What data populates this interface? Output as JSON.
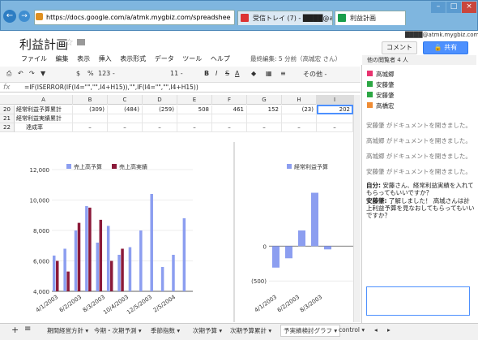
{
  "browser": {
    "url": "https://docs.google.com/a/atmk.mygbiz.com/spreadshee",
    "tabs": [
      {
        "label": "受信トレイ (7) - ████@atmk. ×"
      },
      {
        "label": "利益計画"
      }
    ]
  },
  "header": {
    "title": "利益計画",
    "email": "████@atmk.mygbiz.com",
    "comment_label": "コメント",
    "share_label": "共有",
    "last_edit": "最終編集: 5 分前（高城宏 さん）",
    "menus": [
      "ファイル",
      "編集",
      "表示",
      "挿入",
      "表示形式",
      "データ",
      "ツール",
      "ヘルプ"
    ]
  },
  "toolbar": {
    "currency": "$",
    "percent": "%",
    "format123": "123 -",
    "font_size": "11 -",
    "bold": "B",
    "italic": "I",
    "strike": "S",
    "color": "A",
    "more": "その他 -"
  },
  "formula": {
    "fx": "fx",
    "text": "=IF(ISERROR(IF(I4=\"\",\"\",I4+H15)),\"\",IF(I4=\"\",\"\",I4+H15))"
  },
  "grid": {
    "columns": [
      "A",
      "B",
      "C",
      "D",
      "E",
      "F",
      "G",
      "H",
      "I"
    ],
    "rows": [
      {
        "num": "20",
        "label": "経常利益予算累計",
        "values": [
          "(309)",
          "(484)",
          "(259)",
          "508",
          "461",
          "152",
          "(23)",
          "202"
        ]
      },
      {
        "num": "21",
        "label": "経常利益実績累計",
        "values": [
          "",
          "",
          "",
          "",
          "",
          "",
          "",
          ""
        ]
      },
      {
        "num": "22",
        "label": "達成率",
        "values": [
          "–",
          "–",
          "–",
          "–",
          "–",
          "–",
          "–",
          "–"
        ]
      }
    ]
  },
  "viewers": {
    "label": "他の閲覧者 4 人",
    "list": [
      {
        "name": "高城郷",
        "color": "#e8336f"
      },
      {
        "name": "安藤肇",
        "color": "#2ca744"
      },
      {
        "name": "安藤肇",
        "color": "#2ca744"
      },
      {
        "name": "高橋宏",
        "color": "#ef8c34"
      }
    ]
  },
  "chat": {
    "messages": [
      "安藤肇 がドキュメントを開きました。",
      "高城郷 がドキュメントを開きました。",
      "高城郷 がドキュメントを開きました。",
      "安藤肇 がドキュメントを開きました。"
    ],
    "self_label": "自分:",
    "self_msg": "安藤さん、経常利益実績を入れてもらってもいいですか？",
    "reply_label": "安藤肇:",
    "reply_msg": "了解しました！ 高城さんは計上利益予算を見なおしてもらってもいいですか？"
  },
  "sheets": [
    "期間経営方針",
    "今期・次期予測",
    "季節指数",
    "次期予算",
    "次期予算累計",
    "予実績検討グラフ",
    "control"
  ],
  "chart_data": [
    {
      "type": "bar",
      "series": [
        {
          "name": "売上高予算",
          "color": "#8c9ef0"
        },
        {
          "name": "売上高実績",
          "color": "#8b1a3a"
        }
      ],
      "ytick_labels": [
        "4,000",
        "6,000",
        "8,000",
        "10,000",
        "12,000"
      ],
      "xtick_labels": [
        "4/1/2003",
        "6/2/2003",
        "8/3/2003",
        "10/4/2003",
        "12/5/2003",
        "2/5/2004"
      ],
      "budget": [
        6350,
        6800,
        8000,
        9600,
        7200,
        8300,
        6400,
        6900,
        8000,
        10400,
        5600,
        6400,
        8800
      ],
      "actual": [
        6000,
        5300,
        8500,
        9500,
        8700,
        6000,
        6800
      ],
      "ylim": [
        4000,
        12000
      ]
    },
    {
      "type": "bar",
      "series": [
        {
          "name": "経常利益予算",
          "color": "#8c9ef0"
        }
      ],
      "ytick_labels": [
        "0",
        "(500)"
      ],
      "xtick_labels": [
        "4/1/2003",
        "6/2/2003",
        "8/3/2003"
      ],
      "values": [
        -309,
        -175,
        225,
        767,
        -47
      ]
    }
  ]
}
